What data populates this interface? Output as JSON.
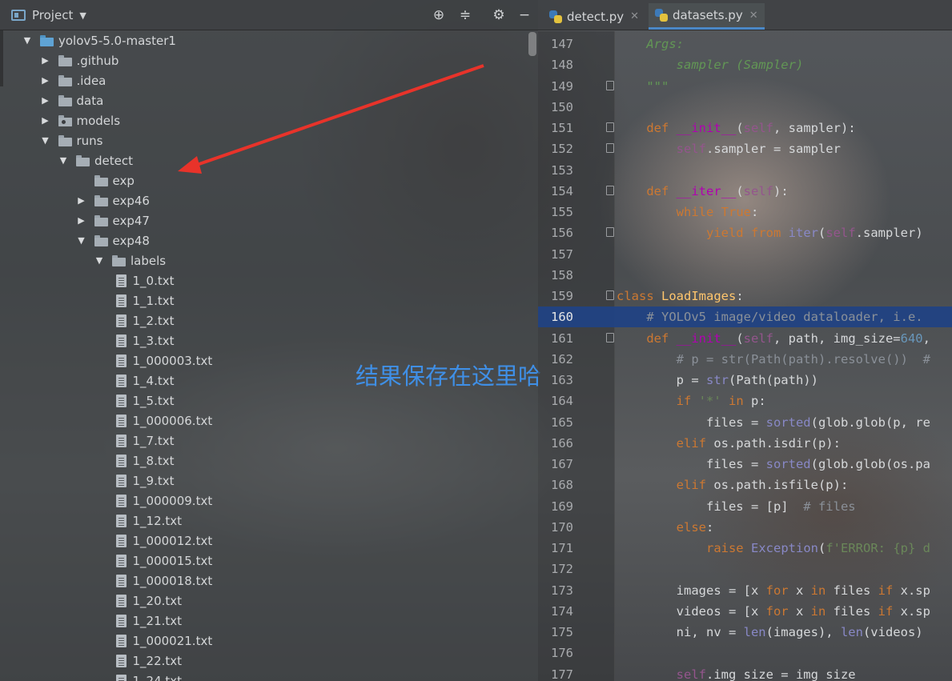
{
  "project_panel": {
    "title": "Project",
    "tree": [
      {
        "label": "yolov5-5.0-master1",
        "type": "root",
        "depth": 0,
        "expanded": true
      },
      {
        "label": ".github",
        "type": "folder",
        "depth": 1,
        "expanded": false
      },
      {
        "label": ".idea",
        "type": "folder",
        "depth": 1,
        "expanded": false
      },
      {
        "label": "data",
        "type": "folder",
        "depth": 1,
        "expanded": false
      },
      {
        "label": "models",
        "type": "package",
        "depth": 1,
        "expanded": false
      },
      {
        "label": "runs",
        "type": "folder",
        "depth": 1,
        "expanded": true
      },
      {
        "label": "detect",
        "type": "folder",
        "depth": 2,
        "expanded": true
      },
      {
        "label": "exp",
        "type": "folder",
        "depth": 3,
        "expanded": null
      },
      {
        "label": "exp46",
        "type": "folder",
        "depth": 3,
        "expanded": false
      },
      {
        "label": "exp47",
        "type": "folder",
        "depth": 3,
        "expanded": false
      },
      {
        "label": "exp48",
        "type": "folder",
        "depth": 3,
        "expanded": true
      },
      {
        "label": "labels",
        "type": "folder",
        "depth": 4,
        "expanded": true
      },
      {
        "label": "1_0.txt",
        "type": "file",
        "depth": 5
      },
      {
        "label": "1_1.txt",
        "type": "file",
        "depth": 5
      },
      {
        "label": "1_2.txt",
        "type": "file",
        "depth": 5
      },
      {
        "label": "1_3.txt",
        "type": "file",
        "depth": 5
      },
      {
        "label": "1_000003.txt",
        "type": "file",
        "depth": 5
      },
      {
        "label": "1_4.txt",
        "type": "file",
        "depth": 5
      },
      {
        "label": "1_5.txt",
        "type": "file",
        "depth": 5
      },
      {
        "label": "1_000006.txt",
        "type": "file",
        "depth": 5
      },
      {
        "label": "1_7.txt",
        "type": "file",
        "depth": 5
      },
      {
        "label": "1_8.txt",
        "type": "file",
        "depth": 5
      },
      {
        "label": "1_9.txt",
        "type": "file",
        "depth": 5
      },
      {
        "label": "1_000009.txt",
        "type": "file",
        "depth": 5
      },
      {
        "label": "1_12.txt",
        "type": "file",
        "depth": 5
      },
      {
        "label": "1_000012.txt",
        "type": "file",
        "depth": 5
      },
      {
        "label": "1_000015.txt",
        "type": "file",
        "depth": 5
      },
      {
        "label": "1_000018.txt",
        "type": "file",
        "depth": 5
      },
      {
        "label": "1_20.txt",
        "type": "file",
        "depth": 5
      },
      {
        "label": "1_21.txt",
        "type": "file",
        "depth": 5
      },
      {
        "label": "1_000021.txt",
        "type": "file",
        "depth": 5
      },
      {
        "label": "1_22.txt",
        "type": "file",
        "depth": 5
      },
      {
        "label": "1_24.txt",
        "type": "file",
        "depth": 5
      }
    ]
  },
  "annotation": {
    "text": "结果保存在这里哈",
    "color": "#3f8fe6",
    "arrow_color": "#e8332a"
  },
  "editor": {
    "tabs": [
      {
        "label": "detect.py",
        "active": false
      },
      {
        "label": "datasets.py",
        "active": true
      }
    ],
    "highlighted_line": 160,
    "lines": [
      {
        "n": "147",
        "text": "    Args:"
      },
      {
        "n": "148",
        "text": "        sampler (Sampler)"
      },
      {
        "n": "149",
        "text": "    \"\"\""
      },
      {
        "n": "150",
        "text": ""
      },
      {
        "n": "151",
        "text": "    def __init__(self, sampler):"
      },
      {
        "n": "152",
        "text": "        self.sampler = sampler"
      },
      {
        "n": "153",
        "text": ""
      },
      {
        "n": "154",
        "text": "    def __iter__(self):"
      },
      {
        "n": "155",
        "text": "        while True:"
      },
      {
        "n": "156",
        "text": "            yield from iter(self.sampler)"
      },
      {
        "n": "157",
        "text": ""
      },
      {
        "n": "158",
        "text": ""
      },
      {
        "n": "159",
        "text": "class LoadImages:"
      },
      {
        "n": "160",
        "text": "    # YOLOv5 image/video dataloader, i.e."
      },
      {
        "n": "161",
        "text": "    def __init__(self, path, img_size=640,"
      },
      {
        "n": "162",
        "text": "        # p = str(Path(path).resolve())  #"
      },
      {
        "n": "163",
        "text": "        p = str(Path(path))"
      },
      {
        "n": "164",
        "text": "        if '*' in p:"
      },
      {
        "n": "165",
        "text": "            files = sorted(glob.glob(p, re"
      },
      {
        "n": "166",
        "text": "        elif os.path.isdir(p):"
      },
      {
        "n": "167",
        "text": "            files = sorted(glob.glob(os.pa"
      },
      {
        "n": "168",
        "text": "        elif os.path.isfile(p):"
      },
      {
        "n": "169",
        "text": "            files = [p]  # files"
      },
      {
        "n": "170",
        "text": "        else:"
      },
      {
        "n": "171",
        "text": "            raise Exception(f'ERROR: {p} d"
      },
      {
        "n": "172",
        "text": ""
      },
      {
        "n": "173",
        "text": "        images = [x for x in files if x.sp"
      },
      {
        "n": "174",
        "text": "        videos = [x for x in files if x.sp"
      },
      {
        "n": "175",
        "text": "        ni, nv = len(images), len(videos)"
      },
      {
        "n": "176",
        "text": ""
      },
      {
        "n": "177",
        "text": "        self.img_size = img_size"
      }
    ]
  }
}
